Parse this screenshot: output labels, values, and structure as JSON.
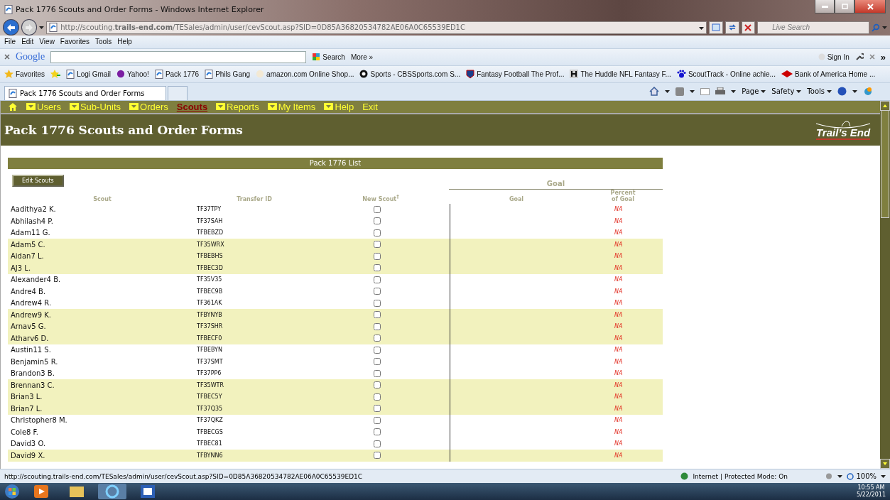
{
  "window": {
    "title": "Pack 1776 Scouts and Order Forms - Windows Internet Explorer"
  },
  "address_bar": {
    "url": "http://scouting.**trails-end.com**/TESales/admin/user/cevScout.asp?SID=0D85A36820534782AE06A0C65539ED1C"
  },
  "live_search": {
    "placeholder": "Live Search"
  },
  "menu_bar": [
    "File",
    "Edit",
    "View",
    "Favorites",
    "Tools",
    "Help"
  ],
  "google_toolbar": {
    "logo": "Google",
    "search": "Search",
    "more": "More »",
    "sign_in": "Sign In",
    "overflow": "»"
  },
  "favorites_bar": {
    "label": "Favorites",
    "links": [
      {
        "label": "Logi Gmail",
        "kind": "page"
      },
      {
        "label": "Yahoo!",
        "kind": "yahoo"
      },
      {
        "label": "Pack 1776",
        "kind": "page"
      },
      {
        "label": "Phils Gang",
        "kind": "page"
      },
      {
        "label": "amazon.com Online Shop...",
        "kind": "amazon"
      },
      {
        "label": "Sports - CBSSports.com S...",
        "kind": "eye"
      },
      {
        "label": "Fantasy Football The Prof...",
        "kind": "nfl"
      },
      {
        "label": "The Huddle NFL Fantasy F...",
        "kind": "huddle"
      },
      {
        "label": "ScoutTrack - Online achie...",
        "kind": "paw"
      },
      {
        "label": "Bank of America  Home  ...",
        "kind": "bank"
      }
    ]
  },
  "tabs": [
    {
      "label": "Pack 1776 Scouts and Order Forms",
      "selected": true
    }
  ],
  "command_bar": [
    "Page",
    "Safety",
    "Tools"
  ],
  "site_nav": [
    {
      "label": "Users",
      "kind": "menu",
      "selected": false
    },
    {
      "label": "Sub-Units",
      "kind": "menu",
      "selected": false
    },
    {
      "label": "Orders",
      "kind": "menu",
      "selected": false
    },
    {
      "label": "Scouts",
      "kind": "link",
      "selected": true
    },
    {
      "label": "Reports",
      "kind": "menu",
      "selected": false
    },
    {
      "label": "My Items",
      "kind": "menu",
      "selected": false
    },
    {
      "label": "Help",
      "kind": "menu",
      "selected": false
    },
    {
      "label": "Exit",
      "kind": "link",
      "selected": false
    }
  ],
  "page": {
    "title": "Pack 1776 Scouts and Order Forms",
    "logo": "Trail’s End"
  },
  "list": {
    "title": "Pack 1776 List",
    "edit_button": "Edit Scouts",
    "goal_group": "Goal",
    "new_scout_mark": "†",
    "columns": [
      "Scout",
      "Transfer ID",
      "New Scout",
      "Goal",
      "Percent of Goal"
    ],
    "rows": [
      {
        "scout": "Aadithya2 K.",
        "transfer_id": "TF37TPY",
        "new_scout": false,
        "percent": "NA"
      },
      {
        "scout": "Abhilash4 P.",
        "transfer_id": "TF37SAH",
        "new_scout": false,
        "percent": "NA"
      },
      {
        "scout": "Adam11 G.",
        "transfer_id": "TFBEBZD",
        "new_scout": false,
        "percent": "NA"
      },
      {
        "scout": "Adam5 C.",
        "transfer_id": "TF35WRX",
        "new_scout": false,
        "percent": "NA"
      },
      {
        "scout": "Aidan7 L.",
        "transfer_id": "TFBEBHS",
        "new_scout": false,
        "percent": "NA"
      },
      {
        "scout": "AJ3 L.",
        "transfer_id": "TFBEC3D",
        "new_scout": false,
        "percent": "NA"
      },
      {
        "scout": "Alexander4 B.",
        "transfer_id": "TF35V35",
        "new_scout": false,
        "percent": "NA"
      },
      {
        "scout": "Andre4 B.",
        "transfer_id": "TFBEC9B",
        "new_scout": false,
        "percent": "NA"
      },
      {
        "scout": "Andrew4 R.",
        "transfer_id": "TF361AK",
        "new_scout": false,
        "percent": "NA"
      },
      {
        "scout": "Andrew9 K.",
        "transfer_id": "TFBYNYB",
        "new_scout": false,
        "percent": "NA"
      },
      {
        "scout": "Arnav5 G.",
        "transfer_id": "TF37SHR",
        "new_scout": false,
        "percent": "NA"
      },
      {
        "scout": "Atharv6 D.",
        "transfer_id": "TFBECF0",
        "new_scout": false,
        "percent": "NA"
      },
      {
        "scout": "Austin11 S.",
        "transfer_id": "TFBEBYN",
        "new_scout": false,
        "percent": "NA"
      },
      {
        "scout": "Benjamin5 R.",
        "transfer_id": "TF37SMT",
        "new_scout": false,
        "percent": "NA"
      },
      {
        "scout": "Brandon3 B.",
        "transfer_id": "TF37PP6",
        "new_scout": false,
        "percent": "NA"
      },
      {
        "scout": "Brennan3 C.",
        "transfer_id": "TF35WTR",
        "new_scout": false,
        "percent": "NA"
      },
      {
        "scout": "Brian3 L.",
        "transfer_id": "TFBEC5Y",
        "new_scout": false,
        "percent": "NA"
      },
      {
        "scout": "Brian7 L.",
        "transfer_id": "TF37Q35",
        "new_scout": false,
        "percent": "NA"
      },
      {
        "scout": "Christopher8 M.",
        "transfer_id": "TF37QKZ",
        "new_scout": false,
        "percent": "NA"
      },
      {
        "scout": "Cole8 F.",
        "transfer_id": "TFBECGS",
        "new_scout": false,
        "percent": "NA"
      },
      {
        "scout": "David3 O.",
        "transfer_id": "TFBEC81",
        "new_scout": false,
        "percent": "NA"
      },
      {
        "scout": "David9 X.",
        "transfer_id": "TFBYNN6",
        "new_scout": false,
        "percent": "NA"
      }
    ]
  },
  "status_bar": {
    "url": "http://scouting.trails-end.com/TESales/admin/user/cevScout.asp?SID=0D85A36820534782AE06A0C65539ED1C",
    "zone": "Internet | Protected Mode: On",
    "zoom": "100%"
  },
  "taskbar": {
    "time": "10:55 AM",
    "date": "5/22/2011"
  }
}
